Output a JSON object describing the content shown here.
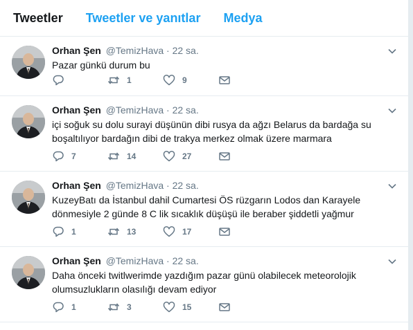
{
  "tabs": {
    "tweets": "Tweetler",
    "tweets_replies": "Tweetler ve yanıtlar",
    "media": "Medya"
  },
  "tweets": [
    {
      "name": "Orhan Şen",
      "handle": "@TemizHava",
      "dot": "·",
      "time": "22 sa.",
      "text": "Pazar günkü durum bu",
      "replies": "",
      "retweets": "1",
      "likes": "9"
    },
    {
      "name": "Orhan Şen",
      "handle": "@TemizHava",
      "dot": "·",
      "time": "22 sa.",
      "text": "içi soğuk su dolu surayi düşünün dibi rusya da ağzı Belarus da bardağa su boşaltılıyor bardağın dibi de trakya merkez olmak üzere marmara",
      "replies": "7",
      "retweets": "14",
      "likes": "27"
    },
    {
      "name": "Orhan Şen",
      "handle": "@TemizHava",
      "dot": "·",
      "time": "22 sa.",
      "text": "KuzeyBatı da İstanbul dahil Cumartesi ÖS rüzgarın Lodos dan Karayele dönmesiyle 2 günde 8 C lik sıcaklık düşüşü ile beraber şiddetli yağmur",
      "replies": "1",
      "retweets": "13",
      "likes": "17"
    },
    {
      "name": "Orhan Şen",
      "handle": "@TemizHava",
      "dot": "·",
      "time": "22 sa.",
      "text": "Daha önceki twitlwerimde yazdığım pazar günü olabilecek meteorolojik olumsuzlukların olasılığı devam ediyor",
      "replies": "1",
      "retweets": "3",
      "likes": "15"
    }
  ],
  "colors": {
    "accent": "#1da1f2",
    "text": "#14171a",
    "muted": "#657786",
    "border": "#e6ecf0"
  },
  "icons": [
    "avatar-photo",
    "chevron-down-icon",
    "reply-icon",
    "retweet-icon",
    "like-icon",
    "direct-message-icon"
  ]
}
